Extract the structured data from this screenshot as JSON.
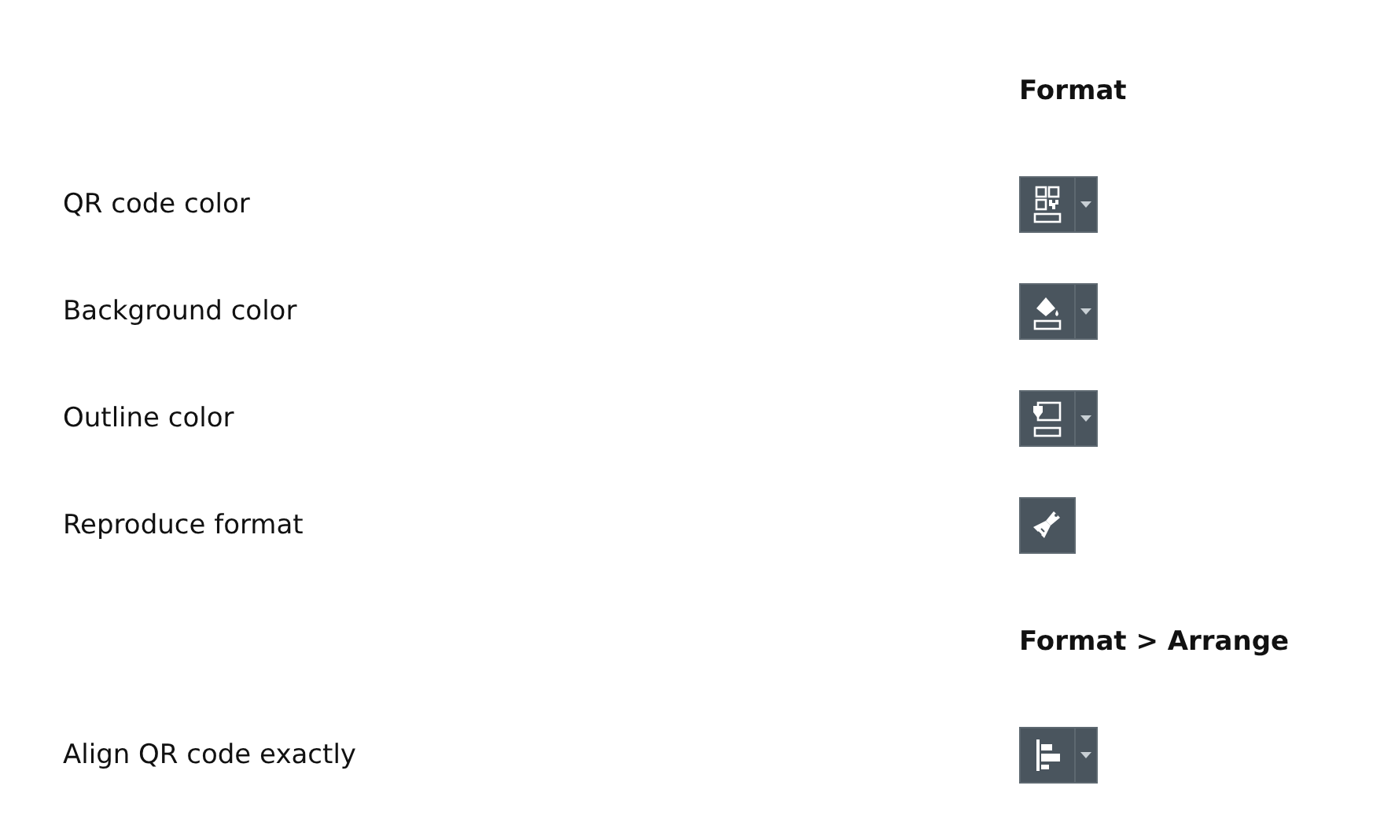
{
  "sections": [
    {
      "heading": "Format",
      "rows": [
        {
          "label": "QR code color",
          "button": {
            "kind": "split"
          }
        },
        {
          "label": "Background color",
          "button": {
            "kind": "split"
          }
        },
        {
          "label": "Outline color",
          "button": {
            "kind": "split"
          }
        },
        {
          "label": "Reproduce format",
          "button": {
            "kind": "single"
          }
        }
      ]
    },
    {
      "heading": "Format > Arrange",
      "rows": [
        {
          "label": "Align QR code exactly",
          "button": {
            "kind": "split"
          }
        }
      ]
    }
  ]
}
